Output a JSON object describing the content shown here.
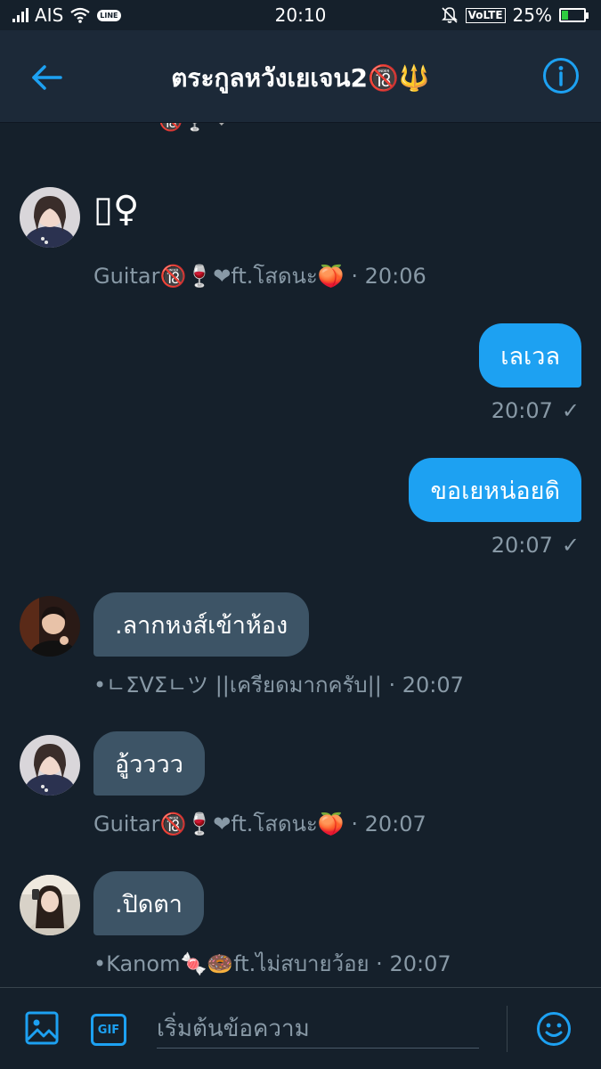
{
  "status_bar": {
    "carrier": "AIS",
    "line_badge": "LINE",
    "time": "20:10",
    "volte": "VoLTE",
    "battery": "25%",
    "battery_level": 0.25
  },
  "header": {
    "title": "ตระกูลหวังเยเจน2🔞🔱"
  },
  "chat": {
    "cut_off_top": "🔞🍷 ❤",
    "messages": [
      {
        "direction": "in",
        "text": "▯♀",
        "sender": "Guitar🔞🍷❤ft.โสดนะ🍑",
        "time": "20:06",
        "meta": "Guitar🔞🍷❤ft.โสดนะ🍑 · 20:06"
      },
      {
        "direction": "out",
        "text": "เลเวล",
        "time": "20:07",
        "check": "✓"
      },
      {
        "direction": "out",
        "text": "ขอเยหน่อยดิ",
        "time": "20:07",
        "check": "✓"
      },
      {
        "direction": "in",
        "text": ".ลากหงส์เข้าห้อง",
        "meta": "•ㄴΣVΣㄴツ ||เครียดมากครับ|| · 20:07"
      },
      {
        "direction": "in",
        "text": "อู้วววว",
        "meta": "Guitar🔞🍷❤ft.โสดนะ🍑 · 20:07"
      },
      {
        "direction": "in",
        "text": ".ปิดตา",
        "meta": "•Kanom🍬🍩ft.ไม่สบายว้อย · 20:07"
      }
    ]
  },
  "composer": {
    "gif_label": "GIF",
    "placeholder": "เริ่มต้นข้อความ"
  },
  "colors": {
    "background": "#15202b",
    "header": "#1c2938",
    "accent": "#1da1f2",
    "incoming_bubble": "#3d5466",
    "meta_text": "#8899a6"
  }
}
